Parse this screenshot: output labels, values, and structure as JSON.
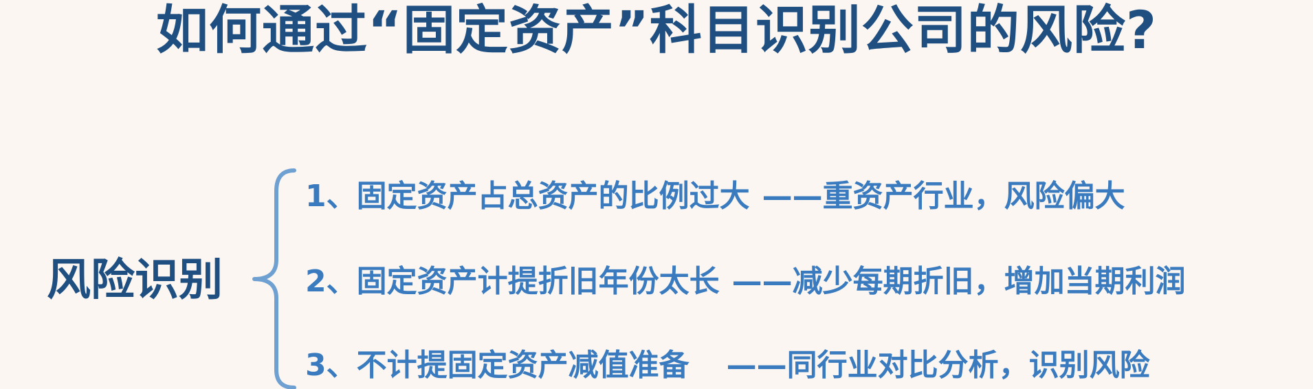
{
  "title": "如何通过“固定资产”科目识别公司的风险?",
  "category_label": "风险识别",
  "items": [
    {
      "point": "1、固定资产占总资产的比例过大",
      "explanation": "——重资产行业，风险偏大"
    },
    {
      "point": "2、固定资产计提折旧年份太长",
      "explanation": "——减少每期折旧，增加当期利润"
    },
    {
      "point": "3、不计提固定资产减值准备",
      "explanation": "——同行业对比分析，识别风险"
    }
  ],
  "colors": {
    "background": "#fbf6f1",
    "title": "#1f4e80",
    "item_text": "#3a7bbf",
    "brace": "#6fa0d2"
  }
}
